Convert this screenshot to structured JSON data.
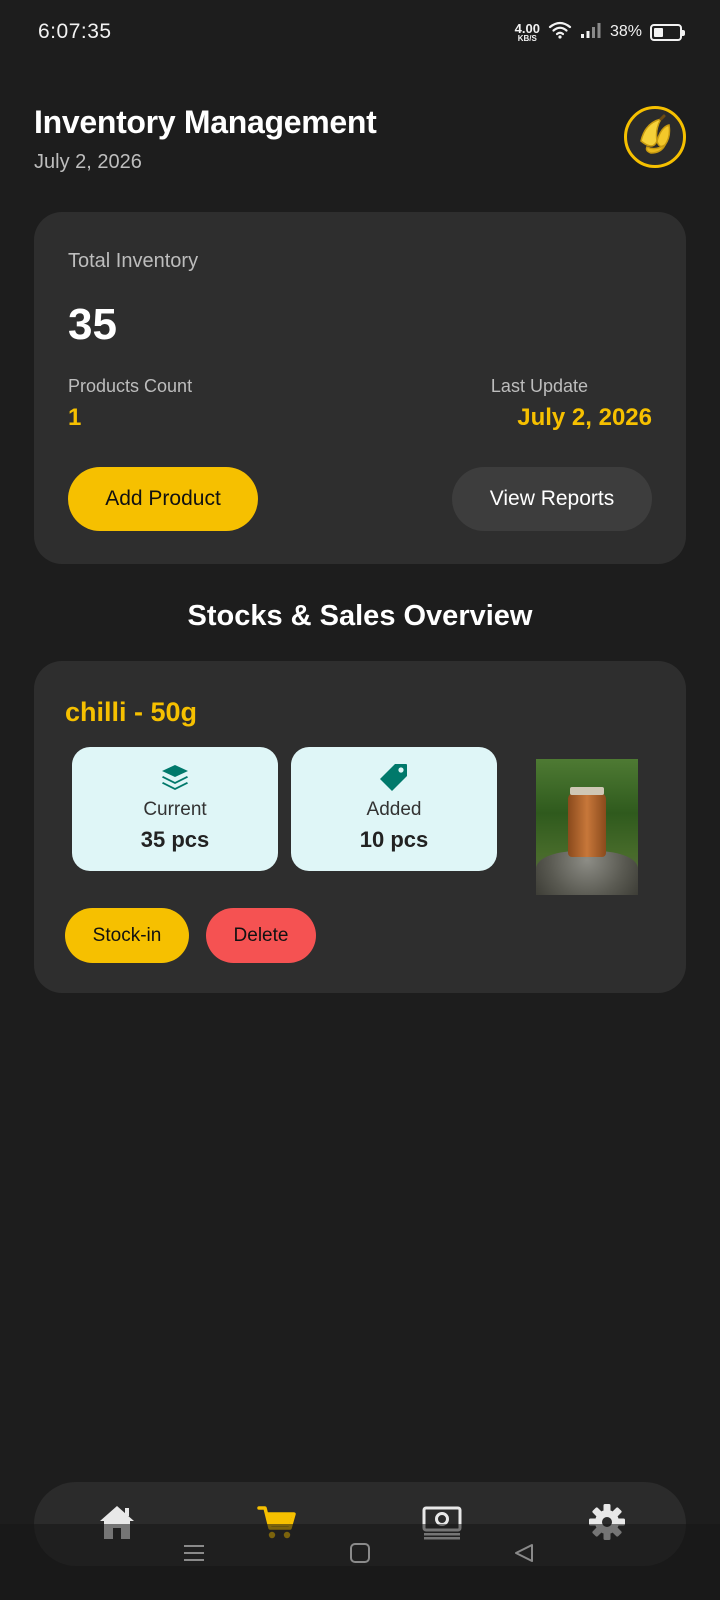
{
  "status_bar": {
    "time": "6:07:35",
    "net_speed_value": "4.00",
    "net_speed_unit": "KB/S",
    "battery_percent": "38%",
    "battery_level": 0.38
  },
  "header": {
    "title": "Inventory Management",
    "date": "July 2, 2026",
    "avatar_icon": "banana-icon"
  },
  "summary": {
    "total_label": "Total Inventory",
    "total_value": "35",
    "count_label": "Products Count",
    "count_value": "1",
    "last_update_label": "Last Update",
    "last_update_value": "July 2, 2026",
    "add_button": "Add Product",
    "reports_button": "View Reports"
  },
  "section": {
    "title": "Stocks & Sales Overview"
  },
  "product": {
    "name": "chilli - 50g",
    "current_label": "Current",
    "current_value": "35 pcs",
    "current_icon": "layers-icon",
    "added_label": "Added",
    "added_value": "10 pcs",
    "added_icon": "tag-icon",
    "stockin_button": "Stock-in",
    "delete_button": "Delete"
  },
  "bottom_nav": {
    "items": [
      {
        "icon": "home-icon",
        "active": false
      },
      {
        "icon": "cart-icon",
        "active": true
      },
      {
        "icon": "money-icon",
        "active": false
      },
      {
        "icon": "gear-icon",
        "active": false
      }
    ]
  },
  "colors": {
    "accent": "#f6c000",
    "danger": "#f55252",
    "background": "#1d1d1d",
    "card": "#2e2e2e",
    "stat_box": "#dff6f7",
    "stat_icon": "#00796b"
  }
}
